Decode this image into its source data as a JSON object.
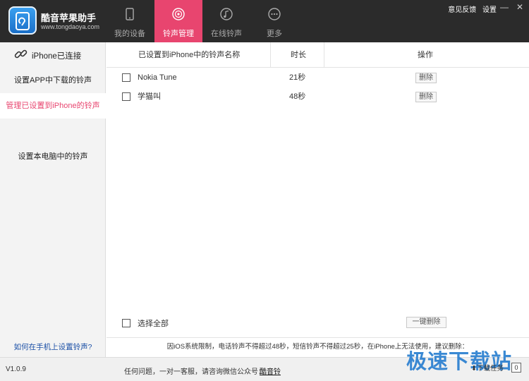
{
  "app": {
    "title": "酷音苹果助手",
    "url": "www.tongdaoya.com"
  },
  "tabs": [
    {
      "label": "我的设备",
      "icon": "phone-icon"
    },
    {
      "label": "铃声管理",
      "icon": "ringtone-icon",
      "active": true
    },
    {
      "label": "在线铃声",
      "icon": "music-note-icon"
    },
    {
      "label": "更多",
      "icon": "more-dots-icon"
    }
  ],
  "toplinks": {
    "feedback": "意见反馈",
    "settings": "设置",
    "minimize": "—",
    "close": "✕"
  },
  "sidebar": {
    "connection": "iPhone已连接",
    "items": [
      {
        "label": "设置APP中下载的铃声"
      },
      {
        "label": "管理已设置到iPhone的铃声",
        "active": true
      },
      {
        "label": "设置本电脑中的铃声"
      }
    ],
    "help": "如何在手机上设置铃声?"
  },
  "table": {
    "headers": {
      "name": "已设置到iPhone中的铃声名称",
      "duration": "时长",
      "action": "操作"
    },
    "rows": [
      {
        "name": "Nokia Tune",
        "duration": "21秒",
        "action": "删除"
      },
      {
        "name": "学猫叫",
        "duration": "48秒",
        "action": "删除"
      }
    ]
  },
  "footer": {
    "select_all": "选择全部",
    "delete_all": "一键删除",
    "notice": "因iOS系统限制，电话铃声不得超过48秒，短信铃声不得超过25秒，在iPhone上无法使用，建议删除："
  },
  "status": {
    "version": "V1.0.9",
    "contact": "任何问题，一对一客服，请咨询微信公众号：",
    "wechat": "酷音铃",
    "download_label": "下载任务",
    "download_count": "0"
  },
  "watermark": "极速下载站",
  "colors": {
    "accent": "#e8456f",
    "topbar": "#2b2b2b",
    "link": "#1a4fa6",
    "watermark": "#2a7fd0"
  }
}
